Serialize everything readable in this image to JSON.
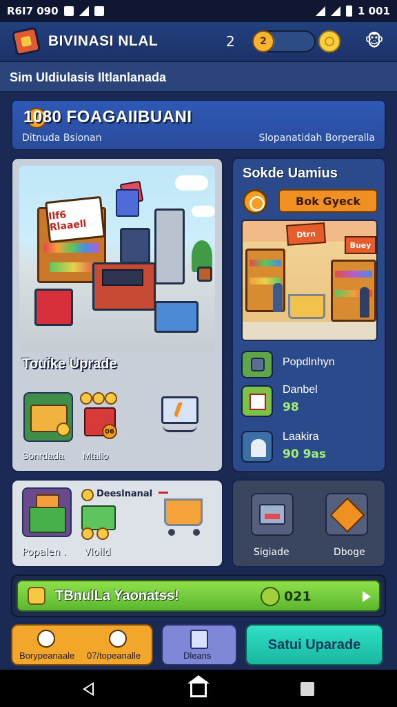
{
  "status_bar": {
    "time_left": "R6I7 090",
    "time_right": "1 001"
  },
  "header": {
    "title": "BIVINASI NLAL",
    "level": "2",
    "xp_badge": "2",
    "xp_progress": 0.35
  },
  "subheader": {
    "text": "Sim Uldiulasis Iltlanlanada"
  },
  "banner": {
    "title": "1080 FOAGAIIBUANI",
    "left_text": "Ditnuda Bsionan",
    "right_text": "Slopanatidah Borperalla"
  },
  "shop_panel": {
    "sign_text": "Ilf6 Rlaaell",
    "title": "Touike Uprade",
    "cards": [
      {
        "label": "Sonrdada"
      },
      {
        "label": "Mtalio"
      }
    ],
    "card2_badge": "06"
  },
  "stock_panel": {
    "title": "Sokde Uamius",
    "button_label": "Bok Gyeck",
    "scene_sign_left": "Dtrn",
    "scene_sign_right": "Buey",
    "stats": [
      {
        "name": "Popdlnhyn",
        "value": ""
      },
      {
        "name": "Danbel",
        "value": "98"
      },
      {
        "name": "Laakira",
        "value": "90 9as"
      }
    ]
  },
  "items_panel": {
    "header_label": "Deeslnanal",
    "items": [
      {
        "label": "Popalen ."
      },
      {
        "label": "Vloild"
      }
    ]
  },
  "tools_panel": {
    "items": [
      {
        "label": "Sigiade"
      },
      {
        "label": "Dboge"
      }
    ]
  },
  "quest": {
    "text": "TBnulLa Yaonatss!",
    "count": "021"
  },
  "actions": {
    "left_a": "Borypeanaale",
    "left_b": "07/topeanalle",
    "middle": "Dleans",
    "right": "Satui Uparade"
  },
  "colors": {
    "accent_green": "#5bb72f",
    "accent_orange": "#f08f22",
    "accent_teal": "#19b79f",
    "header_blue": "#23417f"
  }
}
